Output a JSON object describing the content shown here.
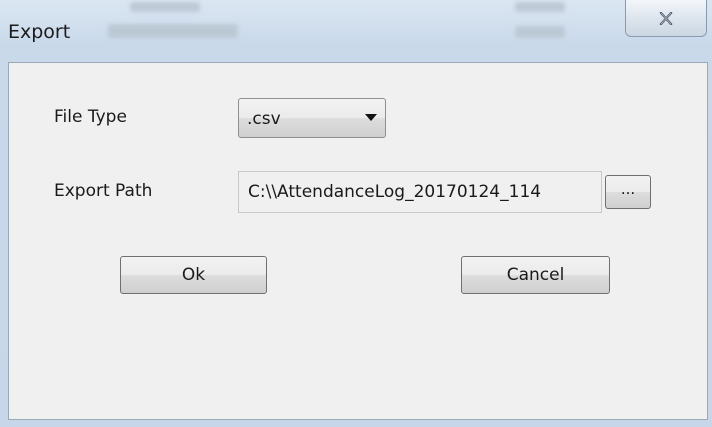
{
  "window": {
    "title": "Export",
    "close_glyph": "close-icon"
  },
  "form": {
    "file_type_label": "File Type",
    "file_type_value": ".csv",
    "export_path_label": "Export Path",
    "export_path_value": "C:\\\\AttendanceLog_20170124_114",
    "browse_label": "...",
    "ok_label": "Ok",
    "cancel_label": "Cancel"
  }
}
